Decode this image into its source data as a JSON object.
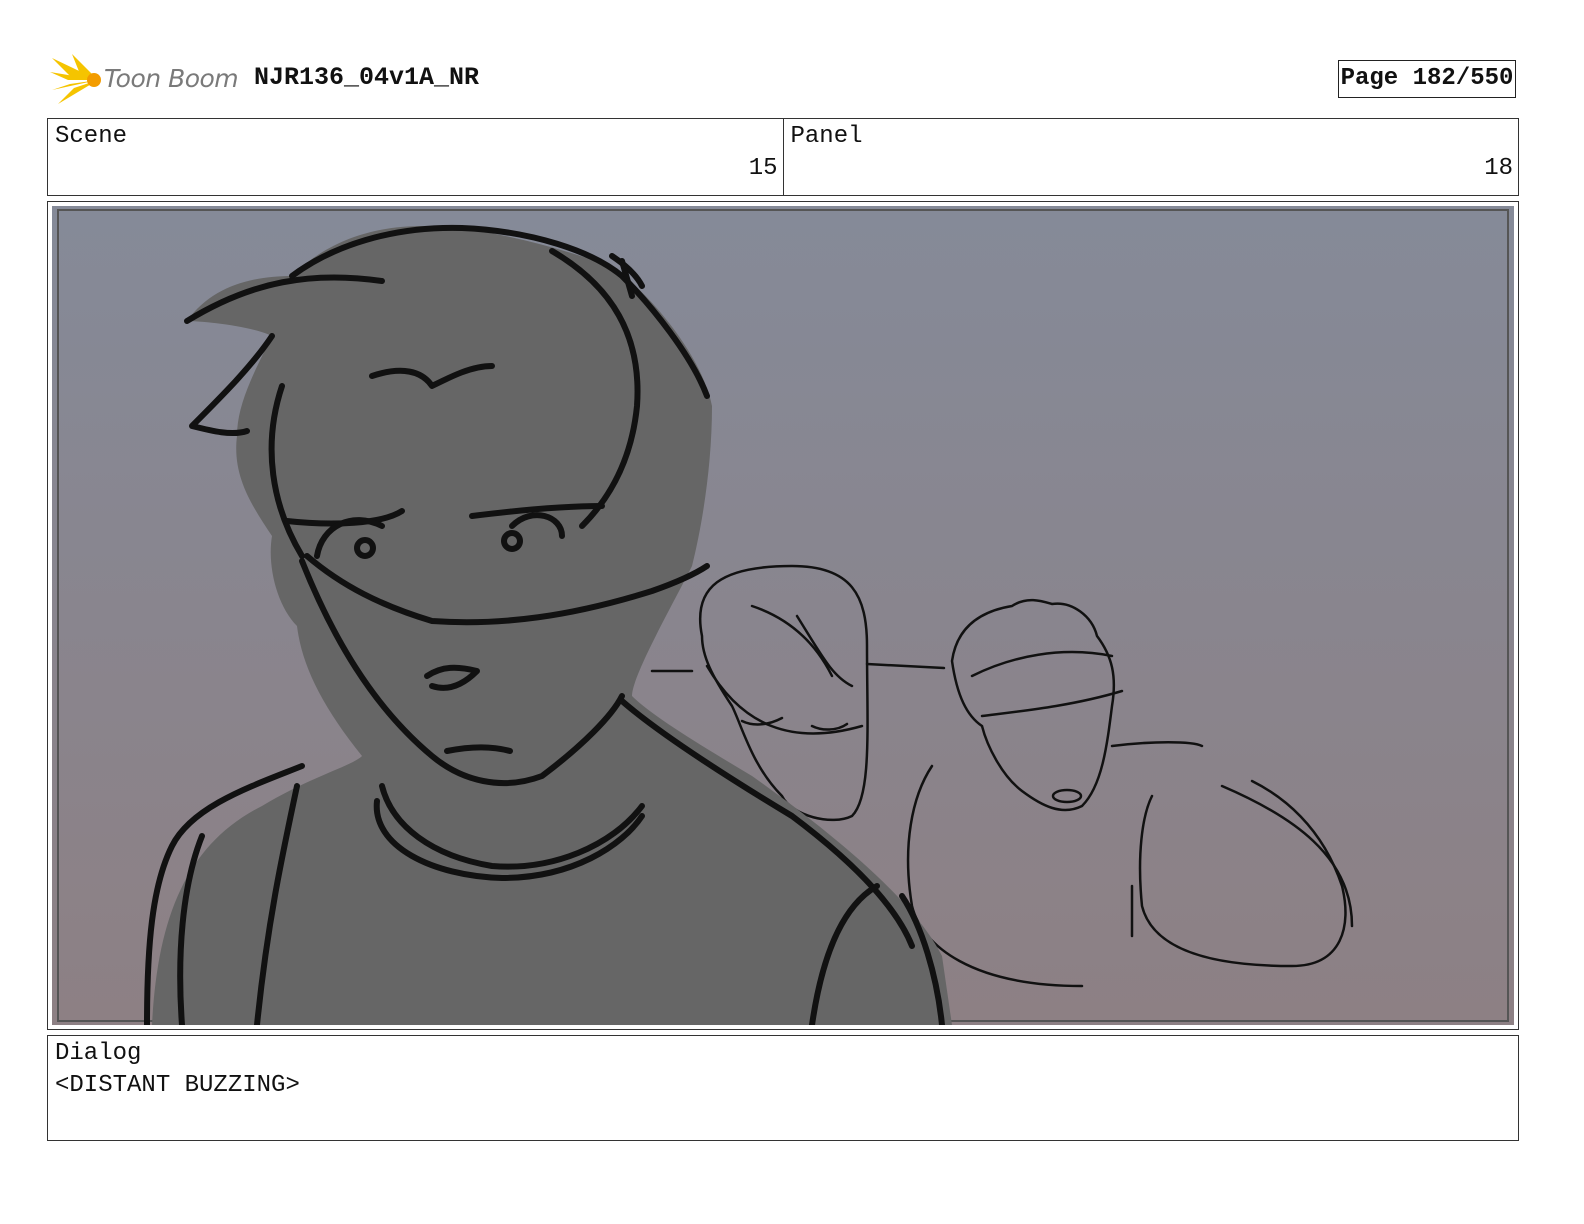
{
  "header": {
    "logo_text": "Toon Boom",
    "doc_title": "NJR136_04v1A_NR",
    "page_label": "Page 182/550"
  },
  "info": {
    "scene_label": "Scene",
    "scene_value": "15",
    "panel_label": "Panel",
    "panel_value": "18"
  },
  "dialog": {
    "label": "Dialog",
    "text": "<DISTANT BUZZING>"
  },
  "colors": {
    "sky_top": "#858a98",
    "sky_bottom": "#8d8084",
    "figure_fill": "#666666",
    "ink": "#111111",
    "logo_yellow": "#f5c400"
  }
}
